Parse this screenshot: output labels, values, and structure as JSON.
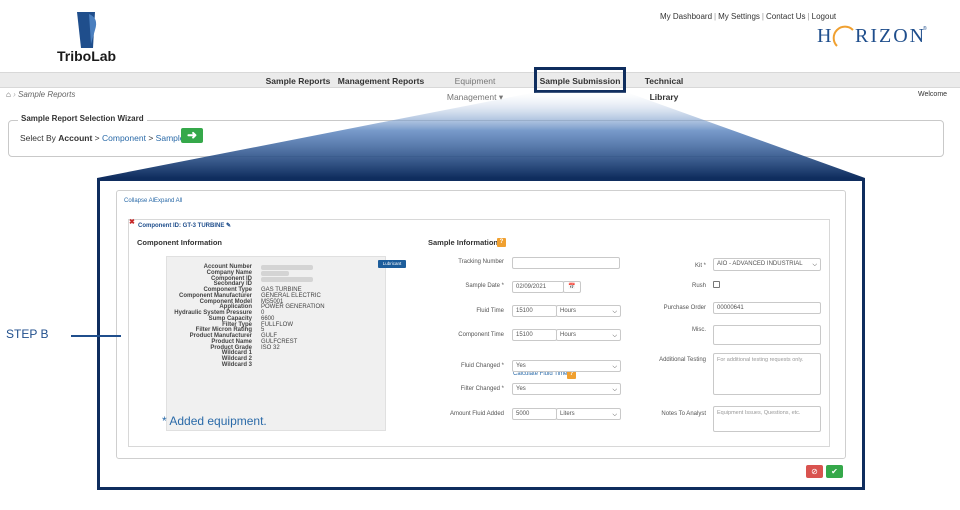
{
  "header": {
    "logo_left": "TriboLab",
    "logo_right": "HORIZON",
    "top_links": [
      "My Dashboard",
      "My Settings",
      "Contact Us",
      "Logout"
    ]
  },
  "nav": {
    "items": [
      "Sample Reports",
      "Management Reports",
      "Equipment Management",
      "Sample Submission",
      "Technical Library"
    ],
    "dropdown_caret": "▾"
  },
  "breadcrumb": {
    "current": "Sample Reports"
  },
  "welcome": "Welcome",
  "wizard": {
    "title": "Sample Report Selection Wizard",
    "select_by": "Select By",
    "account": "Account",
    "component": "Component",
    "sample": "Sample",
    "sep": ">"
  },
  "panel": {
    "collapse_all": "Collapse All",
    "expand_all": "Expand All",
    "component_id_label": "Component ID: GT-3 TURBINE",
    "component_info_title": "Component Information",
    "sample_info_title": "Sample Information",
    "lubricant_badge": "Lubricant",
    "added_note": "* Added equipment.",
    "calc_link": "Calculate Fluid Time"
  },
  "component_info": [
    {
      "label": "Account Number",
      "value": ""
    },
    {
      "label": "Company Name",
      "value": ""
    },
    {
      "label": "Component ID",
      "value": ""
    },
    {
      "label": "Secondary ID",
      "value": ""
    },
    {
      "label": "Component Type",
      "value": "GAS TURBINE"
    },
    {
      "label": "Component Manufacturer",
      "value": "GENERAL ELECTRIC"
    },
    {
      "label": "Component Model",
      "value": "MS5001"
    },
    {
      "label": "Application",
      "value": "POWER GENERATION"
    },
    {
      "label": "Hydraulic System Pressure",
      "value": "0"
    },
    {
      "label": "Sump Capacity",
      "value": "6600"
    },
    {
      "label": "Filter Type",
      "value": "FULLFLOW"
    },
    {
      "label": "Filter Micron Rating",
      "value": "5"
    },
    {
      "label": "Product Manufacturer",
      "value": "GULF"
    },
    {
      "label": "Product Name",
      "value": "GULFCREST"
    },
    {
      "label": "Product Grade",
      "value": "ISO 32"
    },
    {
      "label": "Wildcard 1",
      "value": ""
    },
    {
      "label": "Wildcard 2",
      "value": ""
    },
    {
      "label": "Wildcard 3",
      "value": ""
    }
  ],
  "sample_form": {
    "tracking_number": {
      "label": "Tracking Number",
      "value": ""
    },
    "sample_date": {
      "label": "Sample Date *",
      "value": "02/09/2021"
    },
    "fluid_time": {
      "label": "Fluid Time",
      "value": "15100",
      "unit": "Hours"
    },
    "component_time": {
      "label": "Component Time",
      "value": "15100",
      "unit": "Hours"
    },
    "fluid_changed": {
      "label": "Fluid Changed *",
      "value": "Yes"
    },
    "filter_changed": {
      "label": "Filter Changed *",
      "value": "Yes"
    },
    "amount_fluid_added": {
      "label": "Amount Fluid Added",
      "value": "5000",
      "unit": "Liters"
    },
    "kit": {
      "label": "Kit *",
      "value": "AIO - ADVANCED INDUSTRIAL"
    },
    "rush": {
      "label": "Rush"
    },
    "purchase_order": {
      "label": "Purchase Order",
      "value": "00000641"
    },
    "misc": {
      "label": "Misc.",
      "value": ""
    },
    "additional_testing": {
      "label": "Additional Testing",
      "placeholder": "For additional testing requests only."
    },
    "notes_to_analyst": {
      "label": "Notes To Analyst",
      "placeholder": "Equipment Issues, Questions, etc."
    }
  },
  "buttons": {
    "cancel_glyph": "⊘",
    "submit_glyph": "✔"
  },
  "callout": {
    "step_label": "STEP B"
  },
  "colors": {
    "navy": "#0f2d5e",
    "accent_blue": "#2a6aa8",
    "green": "#35a84a",
    "red": "#d9534f",
    "orange": "#f0a030"
  }
}
